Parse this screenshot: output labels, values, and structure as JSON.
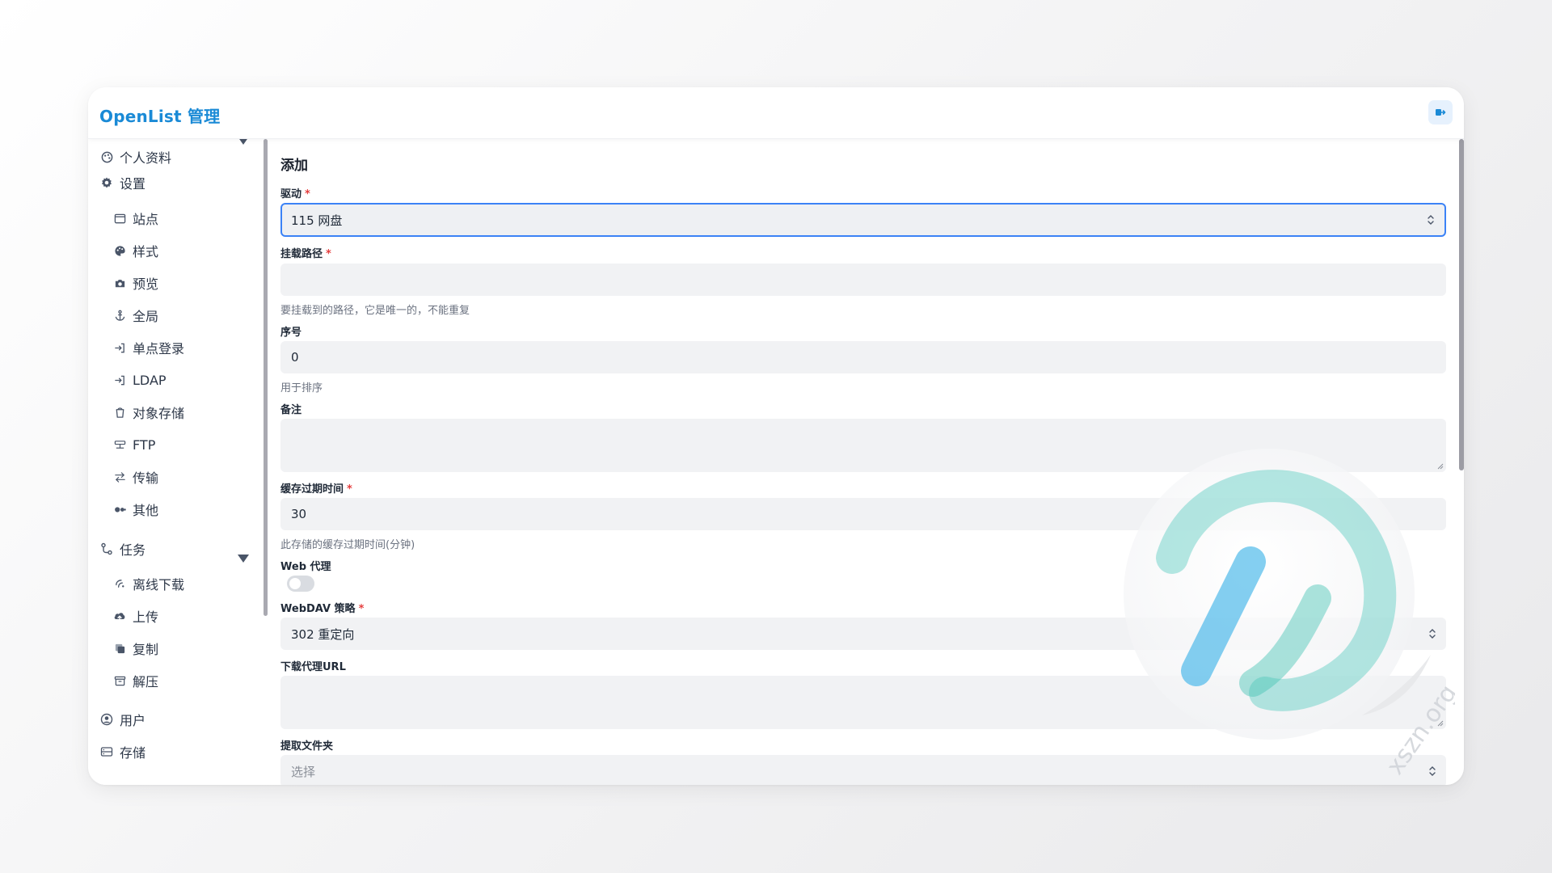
{
  "app": {
    "title": "OpenList 管理"
  },
  "sidebar": {
    "items": [
      {
        "label": "个人资料",
        "icon": "palette-icon"
      },
      {
        "label": "设置",
        "icon": "gear-icon",
        "expanded": true
      },
      {
        "label": "站点",
        "icon": "window-icon"
      },
      {
        "label": "样式",
        "icon": "palette-icon"
      },
      {
        "label": "预览",
        "icon": "camera-icon"
      },
      {
        "label": "全局",
        "icon": "anchor-icon"
      },
      {
        "label": "单点登录",
        "icon": "login-icon"
      },
      {
        "label": "LDAP",
        "icon": "login-icon"
      },
      {
        "label": "对象存储",
        "icon": "bucket-icon"
      },
      {
        "label": "FTP",
        "icon": "server-icon"
      },
      {
        "label": "传输",
        "icon": "transfer-icon"
      },
      {
        "label": "其他",
        "icon": "dots-icon"
      },
      {
        "label": "任务",
        "icon": "task-icon",
        "expanded": true
      },
      {
        "label": "离线下载",
        "icon": "offline-icon"
      },
      {
        "label": "上传",
        "icon": "cloud-upload-icon"
      },
      {
        "label": "复制",
        "icon": "copy-icon"
      },
      {
        "label": "解压",
        "icon": "archive-icon"
      },
      {
        "label": "用户",
        "icon": "user-icon"
      },
      {
        "label": "存储",
        "icon": "storage-icon"
      }
    ]
  },
  "form": {
    "title": "添加",
    "driver": {
      "label": "驱动",
      "value": "115 网盘"
    },
    "mount_path": {
      "label": "挂载路径",
      "value": "",
      "hint": "要挂载到的路径，它是唯一的，不能重复"
    },
    "order": {
      "label": "序号",
      "value": "0",
      "hint": "用于排序"
    },
    "remark": {
      "label": "备注",
      "value": ""
    },
    "cache_expiration": {
      "label": "缓存过期时间",
      "value": "30",
      "hint": "此存储的缓存过期时间(分钟)"
    },
    "web_proxy": {
      "label": "Web 代理",
      "enabled": false
    },
    "webdav_policy": {
      "label": "WebDAV 策略",
      "value": "302 重定向"
    },
    "download_proxy_url": {
      "label": "下载代理URL",
      "value": ""
    },
    "extract_folder": {
      "label": "提取文件夹",
      "placeholder": "选择"
    }
  },
  "watermark": {
    "text": "xszn.org"
  },
  "colors": {
    "brand": "#1a8ad6",
    "required": "#e53e3e",
    "focus": "#3b82f6",
    "field_bg": "#f1f2f4"
  }
}
